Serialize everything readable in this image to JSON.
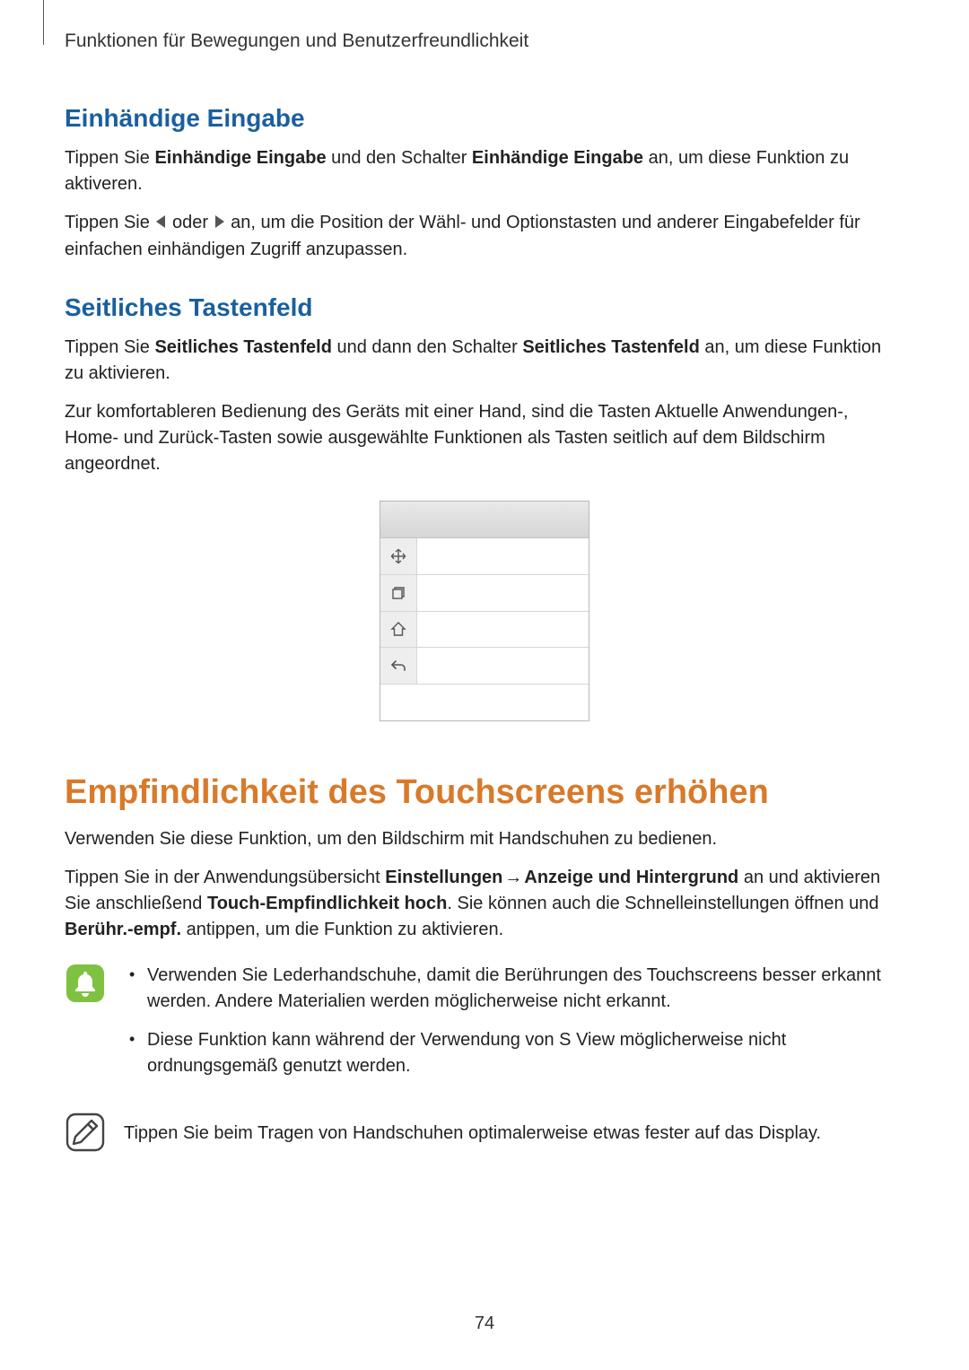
{
  "breadcrumb": "Funktionen für Bewegungen und Benutzerfreundlichkeit",
  "section1": {
    "heading": "Einhändige Eingabe",
    "p1_a": "Tippen Sie ",
    "p1_b1": "Einhändige Eingabe",
    "p1_c": " und den Schalter ",
    "p1_b2": "Einhändige Eingabe",
    "p1_d": " an, um diese Funktion zu aktiveren.",
    "p2_a": "Tippen Sie ",
    "p2_b": " oder ",
    "p2_c": " an, um die Position der Wähl- und Optionstasten und anderer Eingabefelder für einfachen einhändigen Zugriff anzupassen."
  },
  "section2": {
    "heading": "Seitliches Tastenfeld",
    "p1_a": "Tippen Sie ",
    "p1_b1": "Seitliches Tastenfeld",
    "p1_c": " und dann den Schalter ",
    "p1_b2": "Seitliches Tastenfeld",
    "p1_d": " an, um diese Funktion zu aktivieren.",
    "p2": "Zur komfortableren Bedienung des Geräts mit einer Hand, sind die Tasten Aktuelle Anwendungen-, Home- und Zurück-Tasten sowie ausgewählte Funktionen als Tasten seitlich auf dem Bildschirm angeordnet."
  },
  "section3": {
    "heading": "Empfindlichkeit des Touchscreens erhöhen",
    "p1": "Verwenden Sie diese Funktion, um den Bildschirm mit Handschuhen zu bedienen.",
    "p2_a": "Tippen Sie in der Anwendungsübersicht ",
    "p2_b1": "Einstellungen",
    "p2_arrow": "→",
    "p2_b2": "Anzeige und Hintergrund",
    "p2_c": " an und aktivieren Sie anschließend ",
    "p2_b3": "Touch-Empfindlichkeit hoch",
    "p2_d": ". Sie können auch die Schnelleinstellungen öffnen und ",
    "p2_b4": "Berühr.-empf.",
    "p2_e": " antippen, um die Funktion zu aktivieren.",
    "bullets": [
      "Verwenden Sie Lederhandschuhe, damit die Berührungen des Touchscreens besser erkannt werden. Andere Materialien werden möglicherweise nicht erkannt.",
      "Diese Funktion kann während der Verwendung von S View möglicherweise nicht ordnungsgemäß genutzt werden."
    ],
    "tip": "Tippen Sie beim Tragen von Handschuhen optimalerweise etwas fester auf das Display."
  },
  "page_number": "74"
}
